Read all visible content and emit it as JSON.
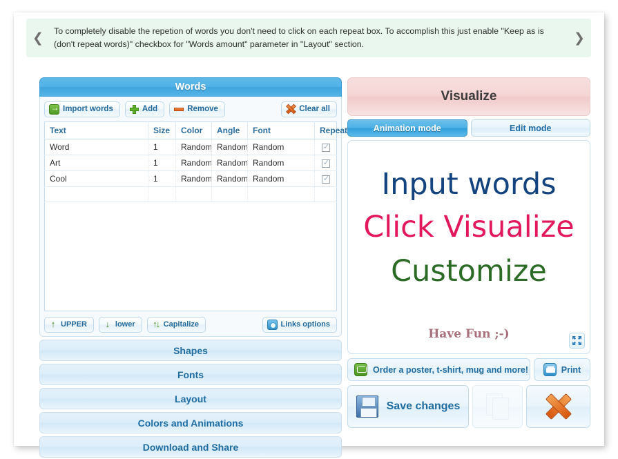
{
  "tip": {
    "prev_icon": "chevron-left-icon",
    "next_icon": "chevron-right-icon",
    "text": "To completely disable the repetion of words you don't need to click on each repeat box. To accomplish this just enable \"Keep as is (don't repeat words)\" checkbox for \"Words amount\" parameter in \"Layout\" section."
  },
  "words_panel": {
    "title": "Words",
    "toolbar": {
      "import_label": "Import words",
      "add_label": "Add",
      "remove_label": "Remove",
      "clear_all_label": "Clear all"
    },
    "table": {
      "columns": [
        "Text",
        "Size",
        "Color",
        "Angle",
        "Font",
        "Repeat?"
      ],
      "rows": [
        {
          "text": "Word",
          "size": "1",
          "color": "Random",
          "angle": "Random",
          "font": "Random",
          "repeat": true
        },
        {
          "text": "Art",
          "size": "1",
          "color": "Random",
          "angle": "Random",
          "font": "Random",
          "repeat": true
        },
        {
          "text": "Cool",
          "size": "1",
          "color": "Random",
          "angle": "Random",
          "font": "Random",
          "repeat": true
        },
        {
          "text": "",
          "size": "",
          "color": "",
          "angle": "",
          "font": "",
          "repeat": null
        }
      ]
    },
    "case_buttons": {
      "upper_label": "UPPER",
      "lower_label": "lower",
      "capitalize_label": "Capitalize",
      "links_options_label": "Links options"
    }
  },
  "sections": [
    {
      "label": "Shapes"
    },
    {
      "label": "Fonts"
    },
    {
      "label": "Layout"
    },
    {
      "label": "Colors and Animations"
    },
    {
      "label": "Download and Share"
    }
  ],
  "visualize_panel": {
    "title": "Visualize",
    "tabs": [
      {
        "label": "Animation mode",
        "active": true
      },
      {
        "label": "Edit mode",
        "active": false
      }
    ],
    "canvas": {
      "words": [
        {
          "text": "Input words",
          "color": "#14447f"
        },
        {
          "text": "Click Visualize",
          "color": "#e3175c"
        },
        {
          "text": "Customize",
          "color": "#2b6b26"
        },
        {
          "text": "Have Fun ;-)",
          "color": "#a8707b"
        }
      ],
      "expand_icon": "fullscreen-expand-icon"
    },
    "actions": {
      "order_label": "Order a poster, t-shirt, mug and more!",
      "print_label": "Print",
      "save_label": "Save changes",
      "duplicate_icon": "duplicate-pages-icon",
      "delete_icon": "delete-x-icon"
    }
  },
  "colors": {
    "panel_blue": "#4fb1e5",
    "panel_pink": "#f5d6d5",
    "tip_green": "#e9f7ee",
    "section_text": "#1f6ca3"
  }
}
